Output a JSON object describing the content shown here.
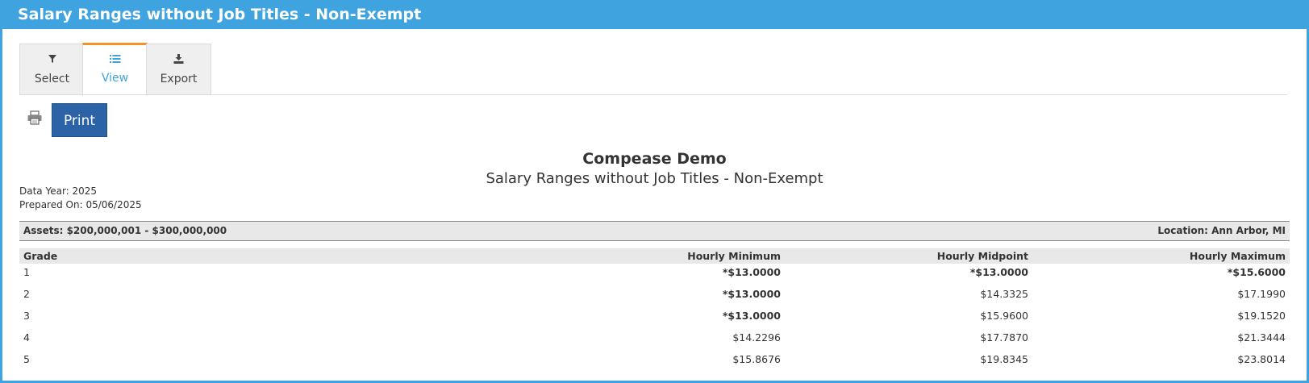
{
  "window": {
    "title": "Salary Ranges without Job Titles - Non-Exempt"
  },
  "tabs": [
    {
      "label": "Select",
      "icon": "filter-icon"
    },
    {
      "label": "View",
      "icon": "list-icon"
    },
    {
      "label": "Export",
      "icon": "download-icon"
    }
  ],
  "active_tab": "View",
  "toolbar": {
    "print_label": "Print",
    "printer_icon": "printer-icon"
  },
  "report": {
    "company": "Compease Demo",
    "title": "Salary Ranges without Job Titles - Non-Exempt",
    "data_year": "Data Year: 2025",
    "prepared_on": "Prepared On: 05/06/2025",
    "assets": "Assets: $200,000,001 - $300,000,000",
    "location": "Location: Ann Arbor, MI"
  },
  "table": {
    "headers": [
      "Grade",
      "Hourly Minimum",
      "Hourly Midpoint",
      "Hourly Maximum"
    ],
    "rows": [
      {
        "grade": "1",
        "min": "*$13.0000",
        "mid": "*$13.0000",
        "max": "*$15.6000",
        "min_bold": true,
        "mid_bold": true,
        "max_bold": true
      },
      {
        "grade": "2",
        "min": "*$13.0000",
        "mid": "$14.3325",
        "max": "$17.1990",
        "min_bold": true,
        "mid_bold": false,
        "max_bold": false
      },
      {
        "grade": "3",
        "min": "*$13.0000",
        "mid": "$15.9600",
        "max": "$19.1520",
        "min_bold": true,
        "mid_bold": false,
        "max_bold": false
      },
      {
        "grade": "4",
        "min": "$14.2296",
        "mid": "$17.7870",
        "max": "$21.3444",
        "min_bold": false,
        "mid_bold": false,
        "max_bold": false
      },
      {
        "grade": "5",
        "min": "$15.8676",
        "mid": "$19.8345",
        "max": "$23.8014",
        "min_bold": false,
        "mid_bold": false,
        "max_bold": false
      }
    ]
  },
  "colors": {
    "accent": "#3ea3de",
    "active_tab_border": "#f0932b",
    "print_button": "#2c63a7",
    "band_bg": "#e8e8e8"
  }
}
